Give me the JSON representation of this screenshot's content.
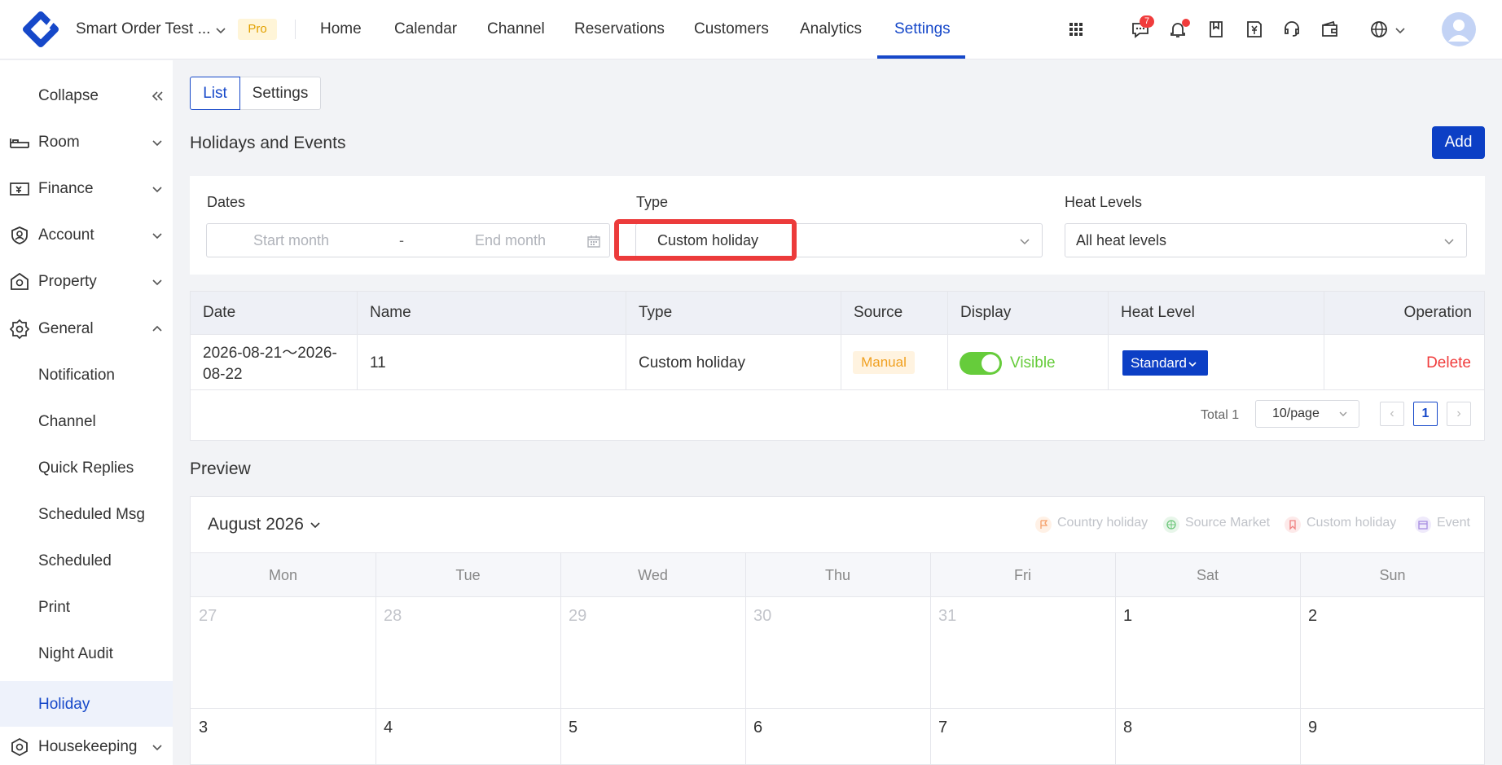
{
  "topbar": {
    "store_name": "Smart Order Test ...",
    "plan_badge": "Pro",
    "nav": [
      "Home",
      "Calendar",
      "Channel",
      "Reservations",
      "Customers",
      "Analytics",
      "Settings"
    ],
    "active_nav": "Settings",
    "message_badge": "7",
    "icons": [
      "apps-grid-icon",
      "message-icon",
      "bell-icon",
      "bookmark-icon",
      "invoice-icon",
      "support-icon",
      "wallet-icon",
      "globe-icon"
    ]
  },
  "sidebar": {
    "collapse": "Collapse",
    "items": [
      {
        "label": "Room",
        "icon": "bed-icon"
      },
      {
        "label": "Finance",
        "icon": "finance-icon"
      },
      {
        "label": "Account",
        "icon": "account-shield-icon"
      },
      {
        "label": "Property",
        "icon": "property-icon"
      },
      {
        "label": "General",
        "icon": "gear-icon"
      }
    ],
    "general_children": [
      "Notification",
      "Channel",
      "Quick Replies",
      "Scheduled Msg",
      "Scheduled",
      "Print",
      "Night Audit",
      "Holiday"
    ],
    "active_child": "Holiday",
    "housekeeping": "Housekeeping"
  },
  "tabs": {
    "list": "List",
    "settings": "Settings"
  },
  "page_title": "Holidays and Events",
  "add_button": "Add",
  "filters": {
    "dates_label": "Dates",
    "start_placeholder": "Start month",
    "dash": "-",
    "end_placeholder": "End month",
    "type_label": "Type",
    "type_value": "Custom holiday",
    "heat_label": "Heat Levels",
    "heat_value": "All heat levels"
  },
  "table": {
    "headers": [
      "Date",
      "Name",
      "Type",
      "Source",
      "Display",
      "Heat Level",
      "Operation"
    ],
    "row": {
      "date_line1": "2026-08-21～2026-",
      "date_line2": "08-22",
      "name": "11",
      "type": "Custom holiday",
      "source": "Manual",
      "display": "Visible",
      "display_on": true,
      "heat_level": "Standard",
      "operation": "Delete"
    },
    "pagination": {
      "total": "Total 1",
      "page_size": "10/page",
      "current_page": "1",
      "prev": "‹",
      "next": "›"
    }
  },
  "preview": {
    "title": "Preview",
    "month": "August 2026",
    "legend": [
      "Country holiday",
      "Source Market",
      "Custom holiday",
      "Event"
    ],
    "weekdays": [
      "Mon",
      "Tue",
      "Wed",
      "Thu",
      "Fri",
      "Sat",
      "Sun"
    ],
    "week1": [
      "27",
      "28",
      "29",
      "30",
      "31",
      "1",
      "2"
    ],
    "week2": [
      "3",
      "4",
      "5",
      "6",
      "7",
      "8",
      "9"
    ]
  },
  "colors": {
    "primary": "#0c3fc5",
    "active_text": "#1648c9",
    "danger": "#f03c3c",
    "success": "#66cc3b",
    "highlight_box": "#ec3b3b"
  }
}
